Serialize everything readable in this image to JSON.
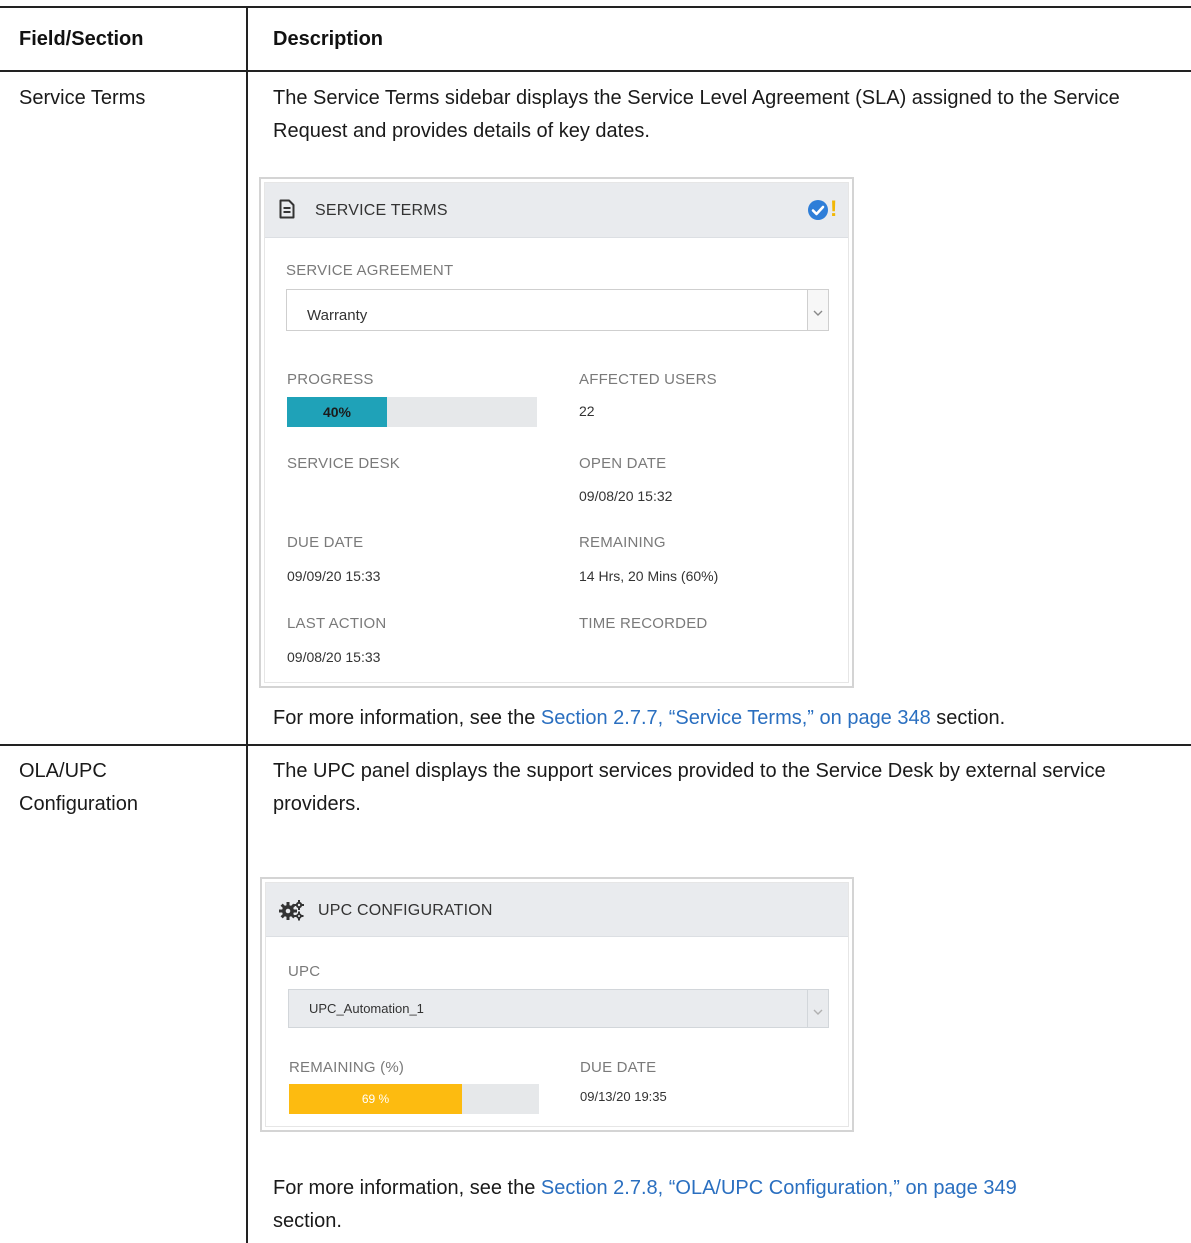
{
  "table": {
    "header": {
      "col1": "Field/Section",
      "col2": "Description"
    },
    "rows": [
      {
        "field": "Service Terms",
        "description": "The Service Terms sidebar displays the Service Level Agreement (SLA) assigned to the Service Request and provides details of key dates.",
        "more_info_prefix": "For more information, see the ",
        "more_info_link": "Section 2.7.7, “Service Terms,” on page 348",
        "more_info_suffix": " section."
      },
      {
        "field": "OLA/UPC Configuration",
        "description": "The UPC panel displays the support services provided to the Service Desk by external service providers.",
        "more_info_prefix": "For more information, see the ",
        "more_info_link": "Section 2.7.8, “OLA/UPC Configuration,” on page 349",
        "more_info_suffix": "section."
      }
    ]
  },
  "service_terms_panel": {
    "title": "SERVICE TERMS",
    "header_icon": "document-icon",
    "status_icon": "check-circle-icon",
    "status_mark": "!",
    "agreement_label": "SERVICE AGREEMENT",
    "agreement_value": "Warranty",
    "progress_label": "PROGRESS",
    "progress_fraction": 0.4,
    "progress_text": "40%",
    "affected_users_label": "AFFECTED USERS",
    "affected_users_value": "22",
    "service_desk_label": "SERVICE DESK",
    "open_date_label": "OPEN DATE",
    "open_date_value": "09/08/20 15:32",
    "due_date_label": "DUE DATE",
    "due_date_value": "09/09/20 15:33",
    "remaining_label": "REMAINING",
    "remaining_value": "14 Hrs, 20 Mins (60%)",
    "last_action_label": "LAST ACTION",
    "last_action_value": "09/08/20 15:33",
    "time_recorded_label": "TIME RECORDED"
  },
  "upc_panel": {
    "title": "UPC CONFIGURATION",
    "header_icon": "gears-icon",
    "upc_label": "UPC",
    "upc_value": "UPC_Automation_1",
    "remaining_label": "REMAINING (%)",
    "remaining_fraction": 0.69,
    "remaining_text": "69 %",
    "due_date_label": "DUE DATE",
    "due_date_value": "09/13/20 19:35"
  },
  "colors": {
    "progress_fill": "#1fa2b8",
    "remaining_fill": "#fdbb10",
    "link": "#2a6fc0",
    "status_check": "#2e7ed8",
    "status_mark": "#f2b705"
  }
}
